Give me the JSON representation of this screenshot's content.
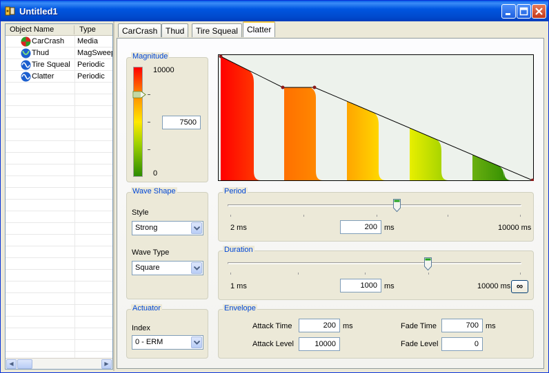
{
  "window": {
    "title": "Untitled1",
    "minimize": "_",
    "maximize": "□",
    "close": "✕"
  },
  "object_list": {
    "headers": {
      "name": "Object Name",
      "type": "Type"
    },
    "items": [
      {
        "name": "CarCrash",
        "type": "Media",
        "icon": "carcrash-icon"
      },
      {
        "name": "Thud",
        "type": "MagSweep",
        "icon": "thud-icon"
      },
      {
        "name": "Tire Squeal",
        "type": "Periodic",
        "icon": "periodic-wave-icon"
      },
      {
        "name": "Clatter",
        "type": "Periodic",
        "icon": "periodic-wave-icon"
      }
    ]
  },
  "tabs": [
    {
      "label": "CarCrash"
    },
    {
      "label": "Thud"
    },
    {
      "label": "Tire Squeal"
    },
    {
      "label": "Clatter",
      "active": true
    }
  ],
  "magnitude": {
    "title": "Magnitude",
    "max_label": "10000",
    "min_label": "0",
    "value": "7500",
    "level_fraction": 0.75
  },
  "wave_shape": {
    "title": "Wave Shape",
    "style_label": "Style",
    "style_value": "Strong",
    "wave_type_label": "Wave Type",
    "wave_type_value": "Square"
  },
  "actuator": {
    "title": "Actuator",
    "index_label": "Index",
    "index_value": "0 - ERM"
  },
  "period": {
    "title": "Period",
    "min_label": "2 ms",
    "max_label": "10000 ms",
    "value": "200",
    "unit": "ms"
  },
  "duration": {
    "title": "Duration",
    "min_label": "1 ms",
    "max_label": "10000 ms",
    "value": "1000",
    "unit": "ms",
    "infinite_label": "∞"
  },
  "envelope": {
    "title": "Envelope",
    "attack_time_label": "Attack Time",
    "attack_time_value": "200",
    "attack_time_unit": "ms",
    "attack_level_label": "Attack Level",
    "attack_level_value": "10000",
    "fade_time_label": "Fade Time",
    "fade_time_value": "700",
    "fade_time_unit": "ms",
    "fade_level_label": "Fade Level",
    "fade_level_value": "0"
  },
  "colors": {
    "group_title": "#0046d5",
    "titlebar": "#0054e3",
    "active_tab_accent": "#ffc83c"
  }
}
